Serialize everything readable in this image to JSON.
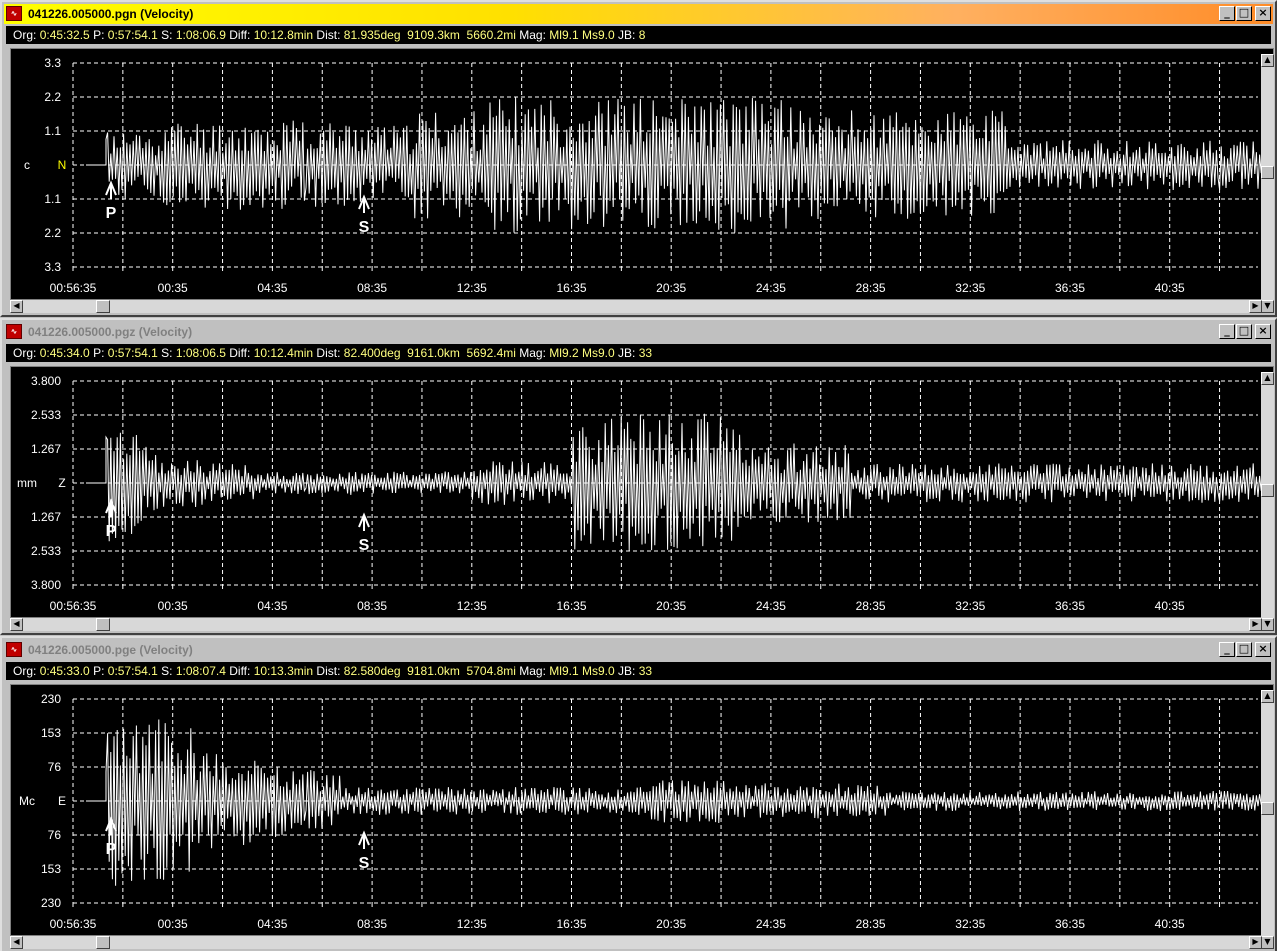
{
  "windows": [
    {
      "title": "041226.005000.pgn (Velocity)",
      "active": true,
      "info": {
        "org": "0:45:32.5",
        "p": "0:57:54.1",
        "s": "1:08:06.9",
        "diff": "10:12.8min",
        "dist": "81.935deg",
        "km": "9109.3km",
        "mi": "5660.2mi",
        "mag": "Ml9.1 Ms9.0",
        "jb": "8"
      },
      "unit": "c",
      "component": "N",
      "y_ticks": [
        "3.3",
        "2.2",
        "1.1",
        "",
        "1.1",
        "2.2",
        "3.3"
      ],
      "x_ticks": [
        "00:56:35",
        "00:35",
        "04:35",
        "08:35",
        "12:35",
        "16:35",
        "20:35",
        "24:35",
        "28:35",
        "32:35",
        "36:35",
        "40:35"
      ],
      "p_label": "P",
      "s_label": "S"
    },
    {
      "title": "041226.005000.pgz (Velocity)",
      "active": false,
      "info": {
        "org": "0:45:34.0",
        "p": "0:57:54.1",
        "s": "1:08:06.5",
        "diff": "10:12.4min",
        "dist": "82.400deg",
        "km": "9161.0km",
        "mi": "5692.4mi",
        "mag": "Ml9.2 Ms9.0",
        "jb": "33"
      },
      "unit": "mm",
      "component": "Z",
      "y_ticks": [
        "3.800",
        "2.533",
        "1.267",
        "",
        "1.267",
        "2.533",
        "3.800"
      ],
      "x_ticks": [
        "00:56:35",
        "00:35",
        "04:35",
        "08:35",
        "12:35",
        "16:35",
        "20:35",
        "24:35",
        "28:35",
        "32:35",
        "36:35",
        "40:35"
      ],
      "p_label": "P",
      "s_label": "S"
    },
    {
      "title": "041226.005000.pge (Velocity)",
      "active": false,
      "info": {
        "org": "0:45:33.0",
        "p": "0:57:54.1",
        "s": "1:08:07.4",
        "diff": "10:13.3min",
        "dist": "82.580deg",
        "km": "9181.0km",
        "mi": "5704.8mi",
        "mag": "Ml9.1 Ms9.0",
        "jb": "33"
      },
      "unit": "Mc",
      "component": "E",
      "y_ticks": [
        "230",
        "153",
        "76",
        "",
        "76",
        "153",
        "230"
      ],
      "x_ticks": [
        "00:56:35",
        "00:35",
        "04:35",
        "08:35",
        "12:35",
        "16:35",
        "20:35",
        "24:35",
        "28:35",
        "32:35",
        "36:35",
        "40:35"
      ],
      "p_label": "P",
      "s_label": "S"
    }
  ],
  "labels": {
    "org": "Org:",
    "p": "P:",
    "s": "S:",
    "diff": "Diff:",
    "dist": "Dist:",
    "mag": "Mag:",
    "jb": "JB:"
  },
  "icons": {
    "app": "seismo-app-icon",
    "min": "minimize-icon",
    "max": "maximize-icon",
    "close": "close-icon"
  },
  "colors": {
    "trace": "#ffffff",
    "grid": "#ffffff",
    "active_title": "#ffff00",
    "info_value": "#ffff80",
    "component_N": "#ffff00"
  }
}
